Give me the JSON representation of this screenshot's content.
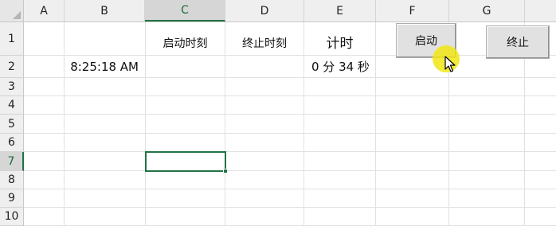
{
  "columns": [
    "A",
    "B",
    "C",
    "D",
    "E",
    "F",
    "G"
  ],
  "rows": [
    "1",
    "2",
    "3",
    "4",
    "5",
    "6",
    "7",
    "8",
    "9",
    "10"
  ],
  "cells": {
    "C1": "启动时刻",
    "D1": "终止时刻",
    "E1": "计时",
    "B2": "8:25:18 AM",
    "E2": "0 分 34 秒"
  },
  "buttons": {
    "start_label": "启动",
    "stop_label": "终止"
  },
  "selection": {
    "active_cell": "C7"
  },
  "colors": {
    "accent": "#217346",
    "cursor_highlight": "#f0e614"
  },
  "icons": {
    "cursor": "arrow-cursor-icon"
  }
}
